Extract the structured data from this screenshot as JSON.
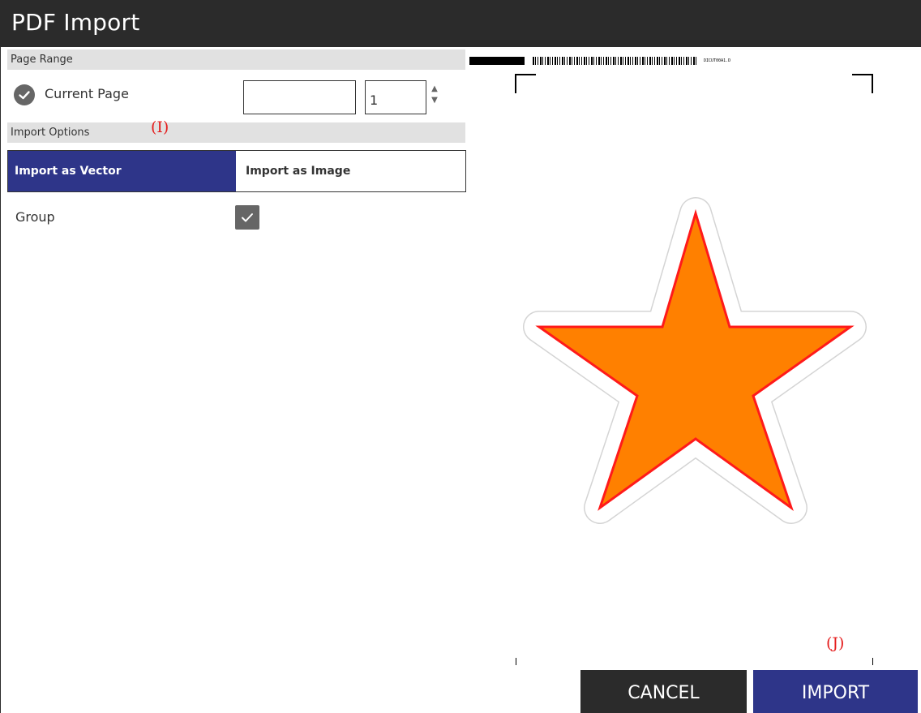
{
  "window": {
    "title": "PDF Import"
  },
  "page_range": {
    "header": "Page Range",
    "current_page_label": "Current Page",
    "text_value": "",
    "page_number": "1"
  },
  "import_options": {
    "header": "Import Options",
    "modes": [
      "Import as Vector",
      "Import as Image"
    ],
    "selected_mode": "Import as Vector",
    "group_label": "Group",
    "group_checked": true
  },
  "annotations": {
    "i": "(I)",
    "j": "(J)"
  },
  "preview": {
    "barcode_caption": "DICUT00A1.D",
    "shape": "star",
    "fill_color": "#ff8000",
    "stroke_color": "#ff1a1a",
    "offset_color": "#d4d4d4"
  },
  "buttons": {
    "cancel": "CANCEL",
    "import": "IMPORT"
  },
  "colors": {
    "titlebar": "#2b2b2b",
    "accent": "#2e3589",
    "section_header": "#e1e1e1"
  }
}
